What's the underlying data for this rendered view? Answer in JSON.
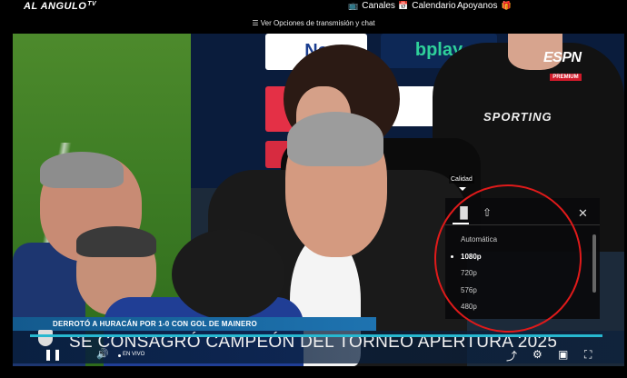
{
  "topbar": {
    "logo": "AL ANGULO",
    "logo_suffix": "TV",
    "nav": [
      {
        "label": "Canales",
        "icon": "tv-icon"
      },
      {
        "label": "Calendario",
        "icon": "calendar-icon"
      },
      {
        "label": "Apoyanos",
        "icon": "gift-icon"
      }
    ]
  },
  "options_bar": {
    "label": "☰ Ver Opciones de transmisión y chat"
  },
  "video": {
    "banners": [
      "Ne",
      "bplay",
      "oa"
    ],
    "shirt_text": "SPORTING",
    "channel_logo": "ESPN",
    "channel_badge": "PREMIUM",
    "ticker": "DERROTÓ A HURACÁN POR 1-0 CON GOL DE MAINERO",
    "headline": "SE CONSAGRÓ CAMPEÓN DEL TORNEO APERTURA 2025",
    "live_label": "EN VIVO"
  },
  "quality_menu": {
    "tooltip": "Calidad",
    "options": [
      {
        "label": "Automática",
        "selected": false
      },
      {
        "label": "1080p",
        "selected": true
      },
      {
        "label": "720p",
        "selected": false
      },
      {
        "label": "576p",
        "selected": false
      },
      {
        "label": "480p",
        "selected": false
      }
    ]
  },
  "colors": {
    "progress": "#27b8d0",
    "annotation": "#e01a1a",
    "ticker_bg": "#1e73b0"
  }
}
